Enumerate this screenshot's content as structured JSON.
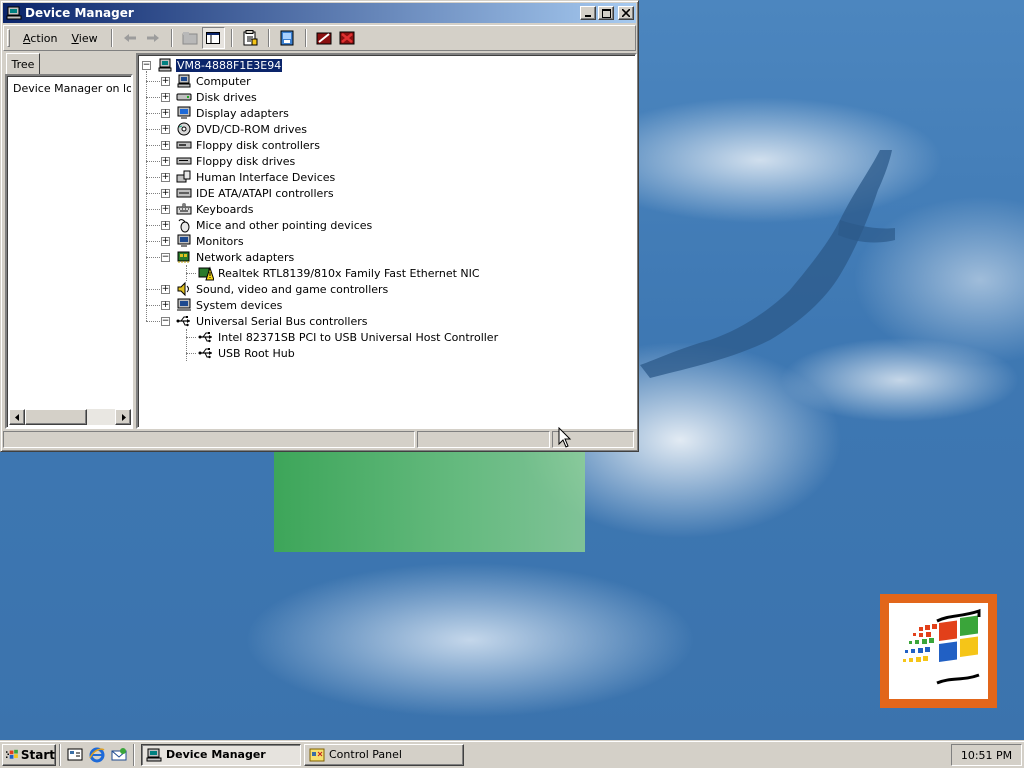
{
  "window": {
    "title": "Device Manager",
    "menu": [
      {
        "label": "Action",
        "mnemonic": "A"
      },
      {
        "label": "View",
        "mnemonic": "V"
      }
    ]
  },
  "left_pane": {
    "tab_label": "Tree",
    "root_label": "Device Manager on lo"
  },
  "tree": {
    "root": "VM8-4888F1E3E94",
    "nodes": [
      {
        "label": "Computer",
        "icon": "computer-icon",
        "expanded": false,
        "children": []
      },
      {
        "label": "Disk drives",
        "icon": "disk-drive-icon",
        "expanded": false,
        "children": []
      },
      {
        "label": "Display adapters",
        "icon": "display-adapter-icon",
        "expanded": false,
        "children": []
      },
      {
        "label": "DVD/CD-ROM drives",
        "icon": "cdrom-icon",
        "expanded": false,
        "children": []
      },
      {
        "label": "Floppy disk controllers",
        "icon": "floppy-controller-icon",
        "expanded": false,
        "children": []
      },
      {
        "label": "Floppy disk drives",
        "icon": "floppy-drive-icon",
        "expanded": false,
        "children": []
      },
      {
        "label": "Human Interface Devices",
        "icon": "hid-icon",
        "expanded": false,
        "children": []
      },
      {
        "label": "IDE ATA/ATAPI controllers",
        "icon": "ide-controller-icon",
        "expanded": false,
        "children": []
      },
      {
        "label": "Keyboards",
        "icon": "keyboard-icon",
        "expanded": false,
        "children": []
      },
      {
        "label": "Mice and other pointing devices",
        "icon": "mouse-icon",
        "expanded": false,
        "children": []
      },
      {
        "label": "Monitors",
        "icon": "monitor-icon",
        "expanded": false,
        "children": []
      },
      {
        "label": "Network adapters",
        "icon": "network-adapter-icon",
        "expanded": true,
        "children": [
          {
            "label": "Realtek RTL8139/810x Family Fast Ethernet NIC",
            "icon": "nic-warning-icon"
          }
        ]
      },
      {
        "label": "Sound, video and game controllers",
        "icon": "sound-icon",
        "expanded": false,
        "children": []
      },
      {
        "label": "System devices",
        "icon": "system-device-icon",
        "expanded": false,
        "children": []
      },
      {
        "label": "Universal Serial Bus controllers",
        "icon": "usb-icon",
        "expanded": true,
        "children": [
          {
            "label": "Intel 82371SB PCI to USB Universal Host Controller",
            "icon": "usb-icon"
          },
          {
            "label": "USB Root Hub",
            "icon": "usb-icon"
          }
        ]
      }
    ]
  },
  "taskbar": {
    "start_label": "Start",
    "tasks": [
      {
        "label": "Device Manager",
        "active": true,
        "icon": "device-manager-icon"
      },
      {
        "label": "Control Panel",
        "active": false,
        "icon": "control-panel-icon"
      }
    ],
    "clock": "10:51 PM"
  },
  "colors": {
    "title_active": "#0a246a",
    "title_gradient_end": "#a6caf0",
    "face": "#d4d0c8",
    "desktop": "#3a6ea5"
  }
}
